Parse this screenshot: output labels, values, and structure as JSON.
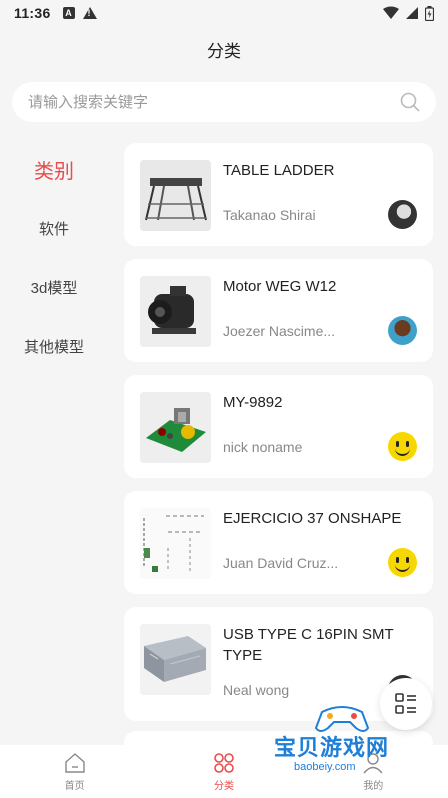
{
  "status": {
    "time": "11:36"
  },
  "header": {
    "title": "分类"
  },
  "search": {
    "placeholder": "请输入搜索关键字"
  },
  "sidebar": {
    "items": [
      {
        "label": "类别"
      },
      {
        "label": "软件"
      },
      {
        "label": "3d模型"
      },
      {
        "label": "其他模型"
      }
    ]
  },
  "cards": [
    {
      "title": "TABLE LADDER",
      "author": "Takanao Shirai"
    },
    {
      "title": "Motor WEG W12",
      "author": "Joezer Nascime..."
    },
    {
      "title": "MY-9892",
      "author": "nick noname"
    },
    {
      "title": "EJERCICIO 37 ONSHAPE",
      "author": "Juan David Cruz..."
    },
    {
      "title": "USB TYPE C 16PIN SMT TYPE",
      "author": "Neal wong"
    }
  ],
  "tabbar": {
    "items": [
      {
        "label": "首页"
      },
      {
        "label": "分类"
      },
      {
        "label": "我的"
      }
    ]
  },
  "watermark": {
    "text": "宝贝游戏网",
    "url": "baobeiy.com"
  },
  "colors": {
    "accent": "#e84c4c",
    "watermark": "#1e7fd8"
  }
}
